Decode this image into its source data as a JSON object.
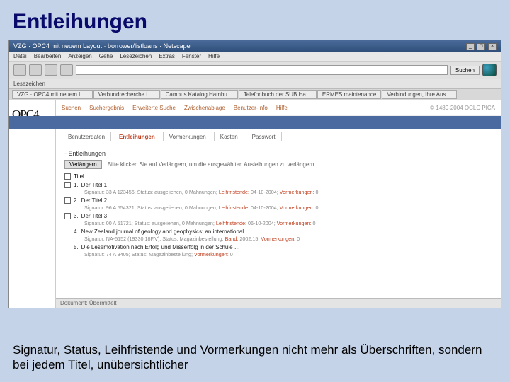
{
  "slide_title": "Entleihungen",
  "slide_caption": "Signatur, Status, Leihfristende und Vormerkungen nicht mehr als Überschriften, sondern bei jedem Titel, unübersichtlicher",
  "browser": {
    "title": "VZG · OPC4 mit neuem Layout · borrower/listloans · Netscape",
    "win_min": "_",
    "win_max": "□",
    "win_close": "×",
    "menu": [
      "Datei",
      "Bearbeiten",
      "Anzeigen",
      "Gehe",
      "Lesezeichen",
      "Extras",
      "Fenster",
      "Hilfe"
    ],
    "search_label": "Suchen",
    "bookmarks_label": "Lesezeichen",
    "tabs": [
      "VZG · OPC4 mit neuem L…",
      "Verbundrecherche L…",
      "Campus Katalog Hambu…",
      "Telefonbuch der SUB Ha…",
      "ERMES maintenance",
      "Verbindungen, Ihre Aus…"
    ]
  },
  "opc": {
    "logo": "OPC4",
    "topnav": [
      "Suchen",
      "Suchergebnis",
      "Erweiterte Suche",
      "Zwischenablage",
      "Benutzer-Info",
      "Hilfe"
    ],
    "right_info": "© 1489-2004 OCLC PICA",
    "subtabs": [
      "Benutzerdaten",
      "Entleihungen",
      "Vormerkungen",
      "Kosten",
      "Passwort"
    ],
    "active_subtab_index": 1,
    "section_title": "-   Entleihungen",
    "renew_btn": "Verlängern",
    "renew_hint": "Bitte klicken Sie auf Verlängern, um die ausgewählten Ausleihungen zu verlängern",
    "list_header": "Titel",
    "items": [
      {
        "num": "1.",
        "title": "Der Titel 1",
        "detail_pre": "Signatur: 33 A 123456; Status: ausgeliehen, 0 Mahnungen; ",
        "leih_lbl": "Leihfristende:",
        "leih_val": " 04-10-2004; ",
        "vorm_lbl": "Vormerkungen:",
        "vorm_val": " 0"
      },
      {
        "num": "2.",
        "title": "Der Titel 2",
        "detail_pre": "Signatur: 96 A 554321; Status: ausgeliehen, 0 Mahnungen; ",
        "leih_lbl": "Leihfristende:",
        "leih_val": " 04-10-2004; ",
        "vorm_lbl": "Vormerkungen:",
        "vorm_val": " 0"
      },
      {
        "num": "3.",
        "title": "Der Titel 3",
        "detail_pre": "Signatur: 00 A 51721; Status: ausgeliehen, 0 Mahnungen; ",
        "leih_lbl": "Leihfristende:",
        "leih_val": " 06-10-2004; ",
        "vorm_lbl": "Vormerkungen:",
        "vorm_val": " 0"
      },
      {
        "num": "4.",
        "title": "New Zealand journal of geology and geophysics: an international …",
        "detail_pre": "Signatur: NA-5152 (19330,18F,V); Status: Magazinbestellung; ",
        "leih_lbl": "Band:",
        "leih_val": " 2002,15; ",
        "vorm_lbl": "Vormerkungen:",
        "vorm_val": " 0"
      },
      {
        "num": "5.",
        "title": "Die Lesemotivation nach Erfolg und Misserfolg in der Schule …",
        "detail_pre": "Signatur: 74 A 3405; Status: Magazinbestellung; ",
        "leih_lbl": "",
        "leih_val": "",
        "vorm_lbl": "Vormerkungen:",
        "vorm_val": " 0"
      }
    ],
    "statusbar_left": "Dokument: Übermittelt",
    "statusbar_right": ""
  }
}
